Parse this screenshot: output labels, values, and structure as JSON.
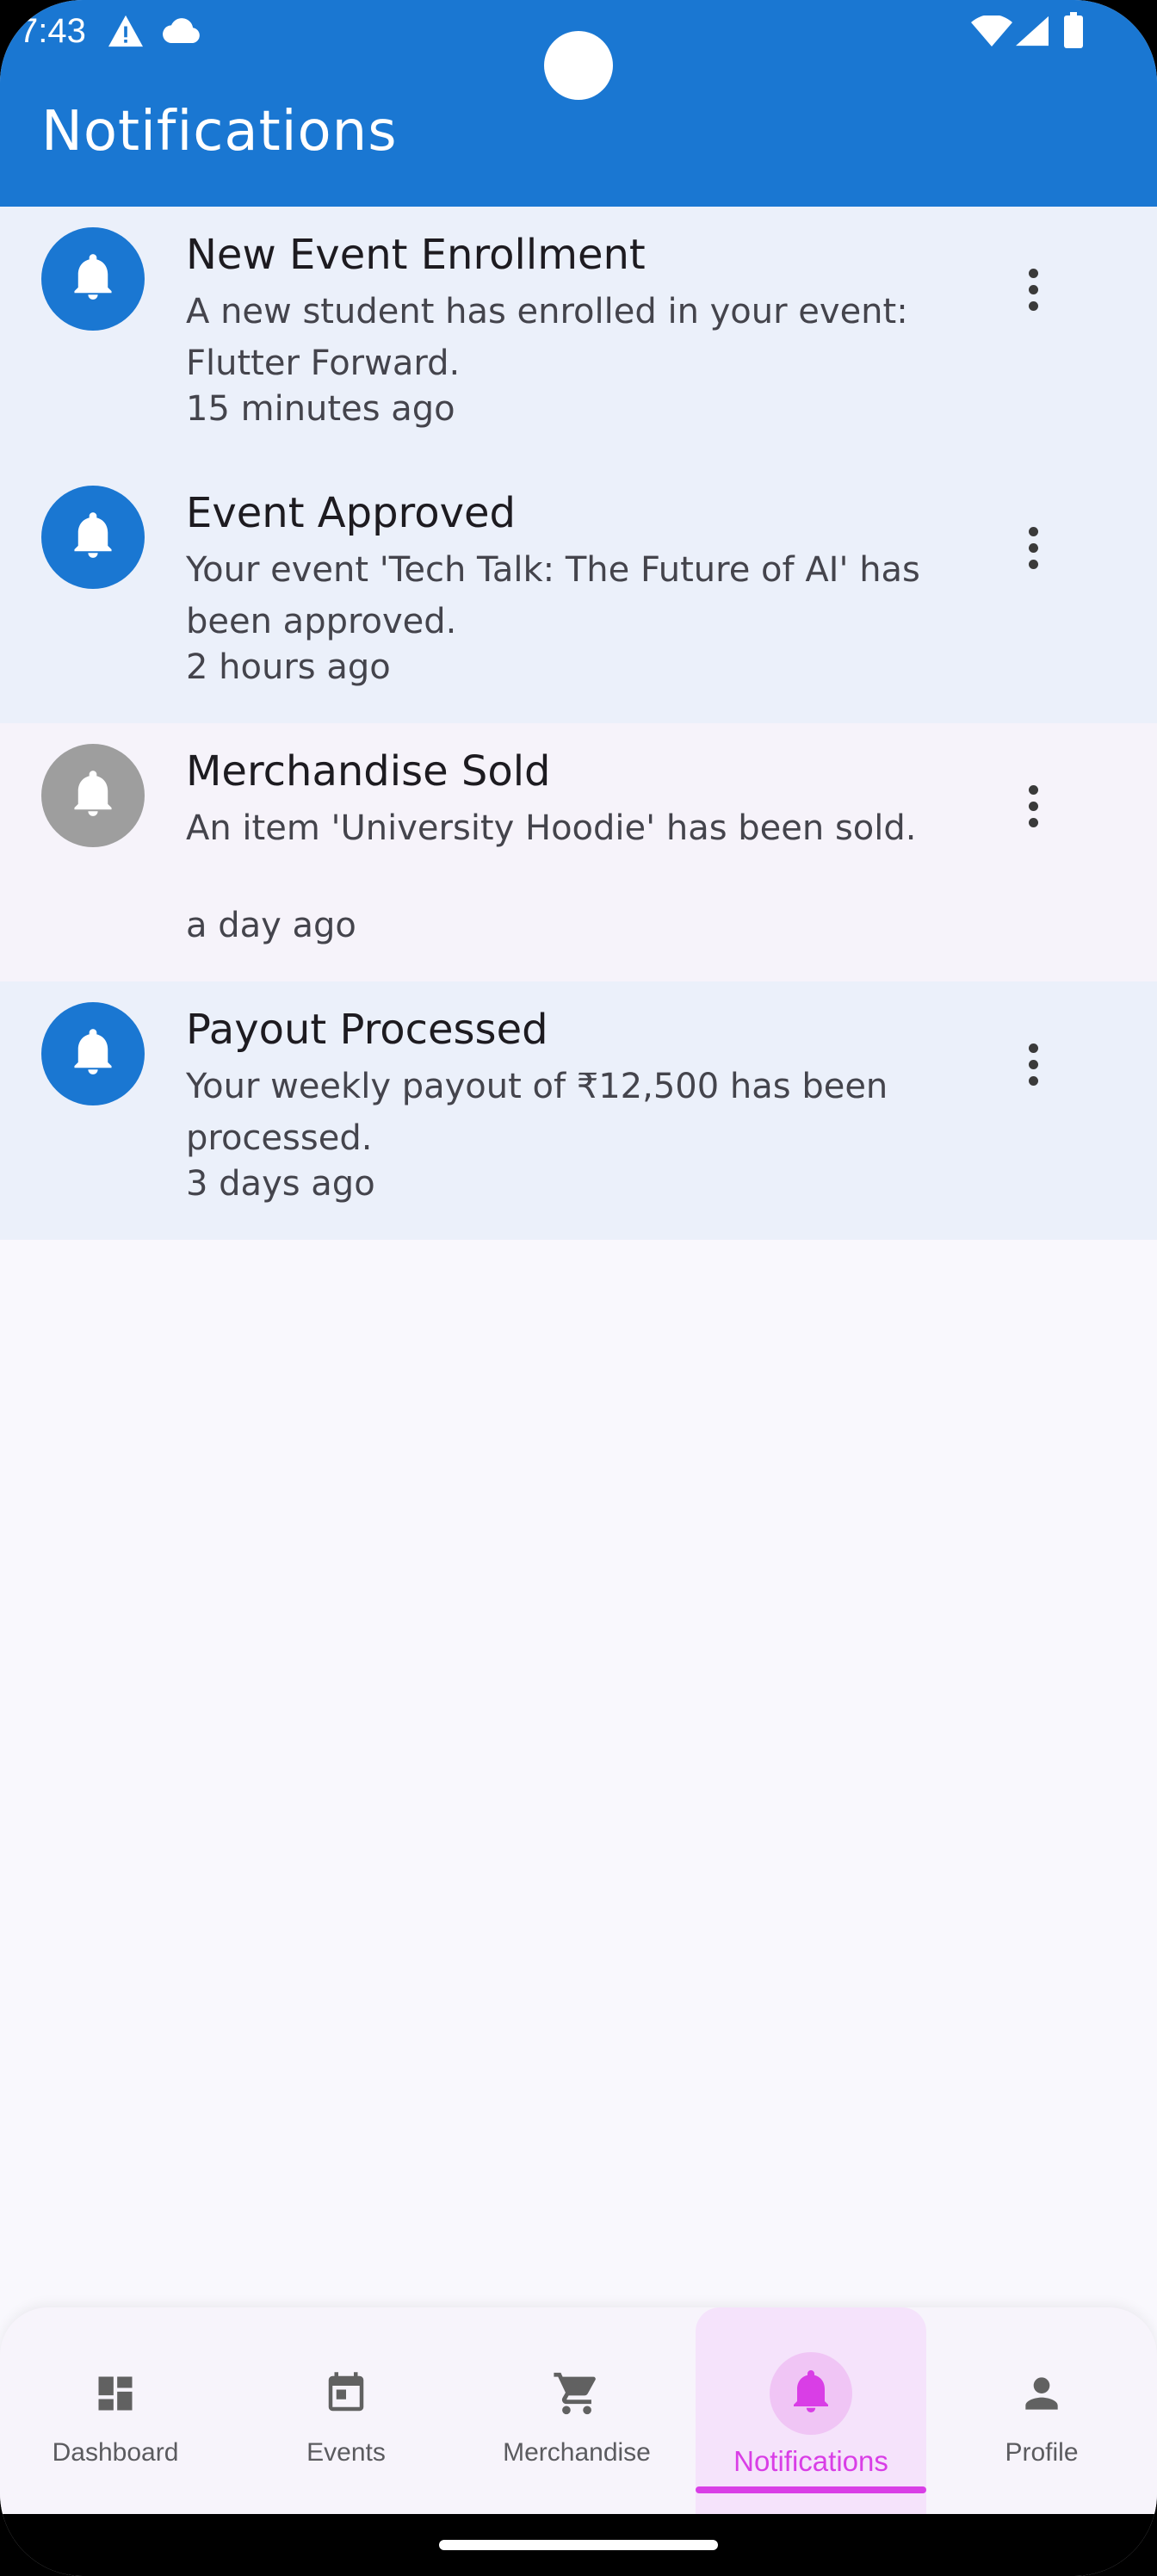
{
  "status_bar": {
    "time": "7:43",
    "icons": [
      "warning-icon",
      "cloud-icon",
      "wifi-icon",
      "signal-icon",
      "battery-icon"
    ]
  },
  "app_bar": {
    "title": "Notifications",
    "color": "#1a77d2"
  },
  "notifications": [
    {
      "title": "New Event Enrollment",
      "body": "A new student has enrolled in your event: Flutter Forward.",
      "time": "15 minutes ago",
      "read": false,
      "icon": "bell-icon"
    },
    {
      "title": "Event Approved",
      "body": "Your event 'Tech Talk: The Future of AI' has been approved.",
      "time": "2 hours ago",
      "read": false,
      "icon": "bell-icon"
    },
    {
      "title": "Merchandise Sold",
      "body": "An item 'University Hoodie' has been sold.",
      "time": "a day ago",
      "read": true,
      "icon": "bell-icon"
    },
    {
      "title": "Payout Processed",
      "body": "Your weekly payout of ₹12,500 has been processed.",
      "time": "3 days ago",
      "read": false,
      "icon": "bell-icon"
    }
  ],
  "bottom_nav": {
    "active": "Notifications",
    "accent": "#d93ee6",
    "items": [
      {
        "label": "Dashboard",
        "icon": "dashboard-icon"
      },
      {
        "label": "Events",
        "icon": "calendar-icon"
      },
      {
        "label": "Merchandise",
        "icon": "cart-icon"
      },
      {
        "label": "Notifications",
        "icon": "bell-icon"
      },
      {
        "label": "Profile",
        "icon": "person-icon"
      }
    ]
  }
}
